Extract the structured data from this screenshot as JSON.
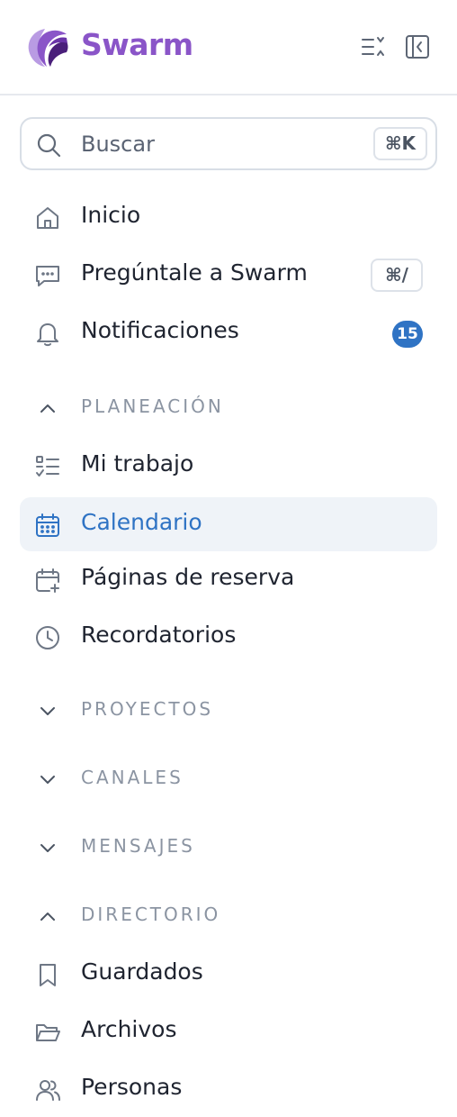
{
  "brand": {
    "name": "Swarm",
    "colors": {
      "brand": "#8a55c8",
      "accent": "#2f73c4",
      "badge": "#2f73c4"
    }
  },
  "header": {
    "icons": [
      "collapse-all-icon",
      "collapse-sidebar-icon"
    ]
  },
  "search": {
    "placeholder": "Buscar",
    "shortcut": "⌘K"
  },
  "nav": {
    "home": {
      "label": "Inicio",
      "icon": "home-icon"
    },
    "ask": {
      "label": "Pregúntale a Swarm",
      "icon": "chat-icon",
      "shortcut": "⌘/"
    },
    "notifications": {
      "label": "Notificaciones",
      "icon": "bell-icon",
      "badge": "15"
    }
  },
  "sections": {
    "planning": {
      "label": "PLANEACIÓN",
      "expanded": true,
      "items": [
        {
          "label": "Mi trabajo",
          "icon": "checklist-icon"
        },
        {
          "label": "Calendario",
          "icon": "calendar-icon",
          "active": true
        },
        {
          "label": "Páginas de reserva",
          "icon": "calendar-plus-icon"
        },
        {
          "label": "Recordatorios",
          "icon": "clock-icon"
        }
      ]
    },
    "projects": {
      "label": "PROYECTOS",
      "expanded": false
    },
    "channels": {
      "label": "CANALES",
      "expanded": false
    },
    "messages": {
      "label": "MENSAJES",
      "expanded": false
    },
    "directory": {
      "label": "DIRECTORIO",
      "expanded": true,
      "items": [
        {
          "label": "Guardados",
          "icon": "bookmark-icon"
        },
        {
          "label": "Archivos",
          "icon": "folder-icon"
        },
        {
          "label": "Personas",
          "icon": "users-icon"
        }
      ]
    }
  }
}
